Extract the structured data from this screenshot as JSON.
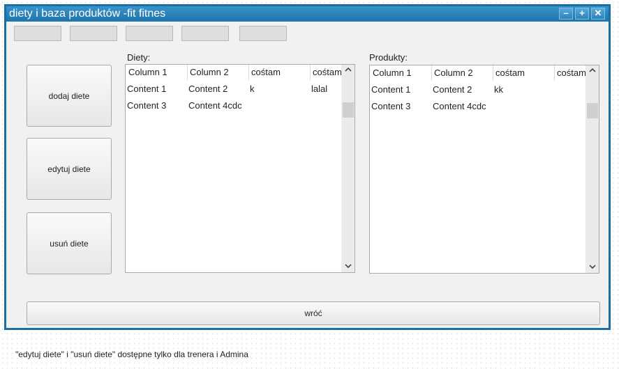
{
  "window": {
    "title": "diety i baza produktów -fit fitnes"
  },
  "window_controls": {
    "minimize": "–",
    "maximize": "+",
    "close": "✕"
  },
  "toolbar": {
    "tabs": [
      "",
      "",
      "",
      "",
      ""
    ]
  },
  "sidebar": {
    "add_label": "dodaj diete",
    "edit_label": "edytuj diete",
    "delete_label": "usuń diete"
  },
  "diets": {
    "label": "Diety:",
    "columns": [
      "Column 1",
      "Column 2",
      "cośtam",
      "cośtam"
    ],
    "rows": [
      [
        "Content 1",
        "Content 2",
        "k",
        "lalal"
      ],
      [
        "Content 3",
        "Content 4cdc",
        "",
        ""
      ]
    ]
  },
  "products": {
    "label": "Produkty:",
    "columns": [
      "Column 1",
      "Column 2",
      "cośtam",
      "cośtam"
    ],
    "rows": [
      [
        "Content 1",
        "Content 2",
        "kk",
        ""
      ],
      [
        "Content 3",
        "Content 4cdc",
        "",
        ""
      ]
    ]
  },
  "footer": {
    "back_label": "wróć"
  },
  "note": "\"edytuj diete\" i \"usuń diete\" dostępne tylko dla trenera i Admina"
}
